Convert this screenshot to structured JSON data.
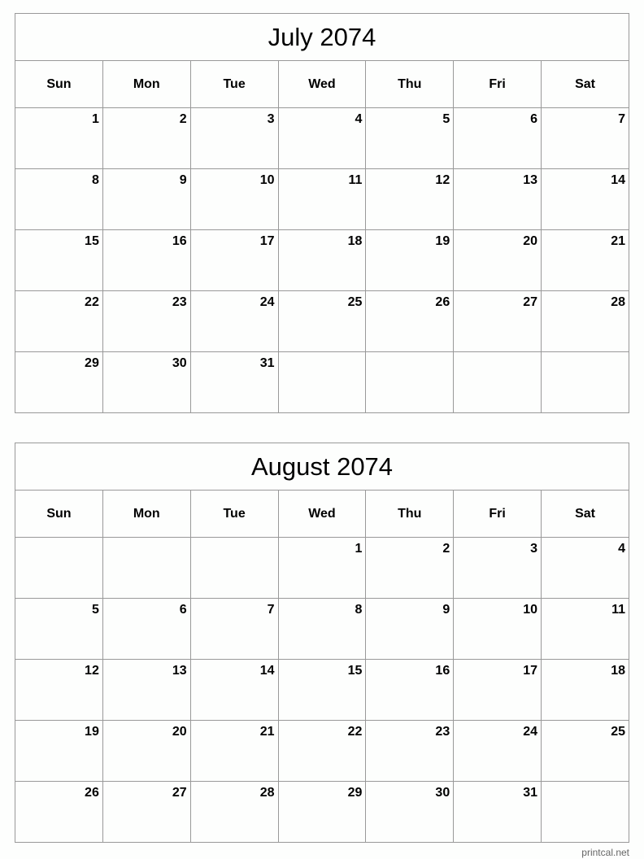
{
  "weekdays": [
    "Sun",
    "Mon",
    "Tue",
    "Wed",
    "Thu",
    "Fri",
    "Sat"
  ],
  "calendars": [
    {
      "title": "July 2074",
      "weeks": [
        [
          "1",
          "2",
          "3",
          "4",
          "5",
          "6",
          "7"
        ],
        [
          "8",
          "9",
          "10",
          "11",
          "12",
          "13",
          "14"
        ],
        [
          "15",
          "16",
          "17",
          "18",
          "19",
          "20",
          "21"
        ],
        [
          "22",
          "23",
          "24",
          "25",
          "26",
          "27",
          "28"
        ],
        [
          "29",
          "30",
          "31",
          "",
          "",
          "",
          ""
        ]
      ]
    },
    {
      "title": "August 2074",
      "weeks": [
        [
          "",
          "",
          "",
          "1",
          "2",
          "3",
          "4"
        ],
        [
          "5",
          "6",
          "7",
          "8",
          "9",
          "10",
          "11"
        ],
        [
          "12",
          "13",
          "14",
          "15",
          "16",
          "17",
          "18"
        ],
        [
          "19",
          "20",
          "21",
          "22",
          "23",
          "24",
          "25"
        ],
        [
          "26",
          "27",
          "28",
          "29",
          "30",
          "31",
          ""
        ]
      ]
    }
  ],
  "footer": "printcal.net"
}
